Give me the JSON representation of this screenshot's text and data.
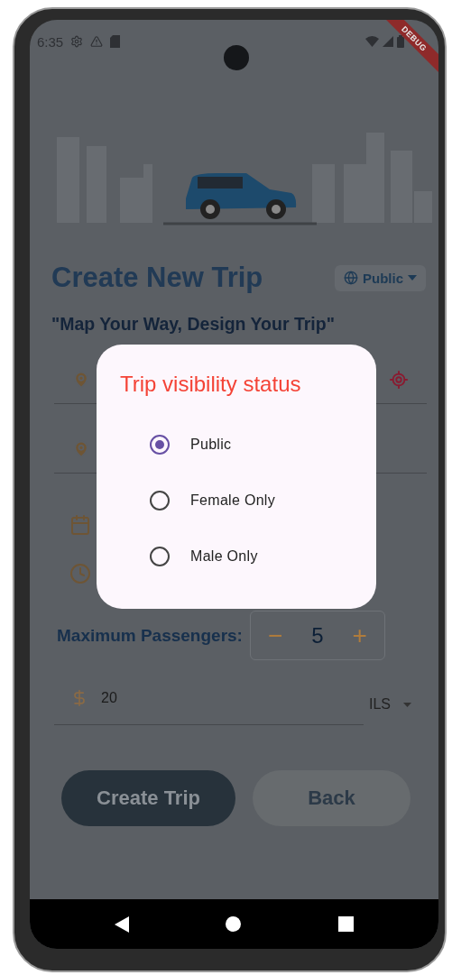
{
  "status_bar": {
    "time": "6:35"
  },
  "debug_banner": "DEBUG",
  "header": {
    "title": "Create New Trip",
    "visibility_dropdown": "Public"
  },
  "subtitle": "\"Map Your Way, Design Your Trip\"",
  "passengers": {
    "label": "Maximum Passengers:",
    "decrement": "−",
    "count": "5",
    "increment": "+"
  },
  "price": {
    "value": "20",
    "currency": "ILS"
  },
  "buttons": [
    {
      "label": "Create Trip",
      "kind": "primary"
    },
    {
      "label": "Back",
      "kind": "secondary"
    }
  ],
  "visibility_dialog": {
    "title": "Trip visibility status",
    "options": [
      {
        "label": "Public",
        "selected": true
      },
      {
        "label": "Female Only",
        "selected": false
      },
      {
        "label": "Male Only",
        "selected": false
      }
    ]
  }
}
